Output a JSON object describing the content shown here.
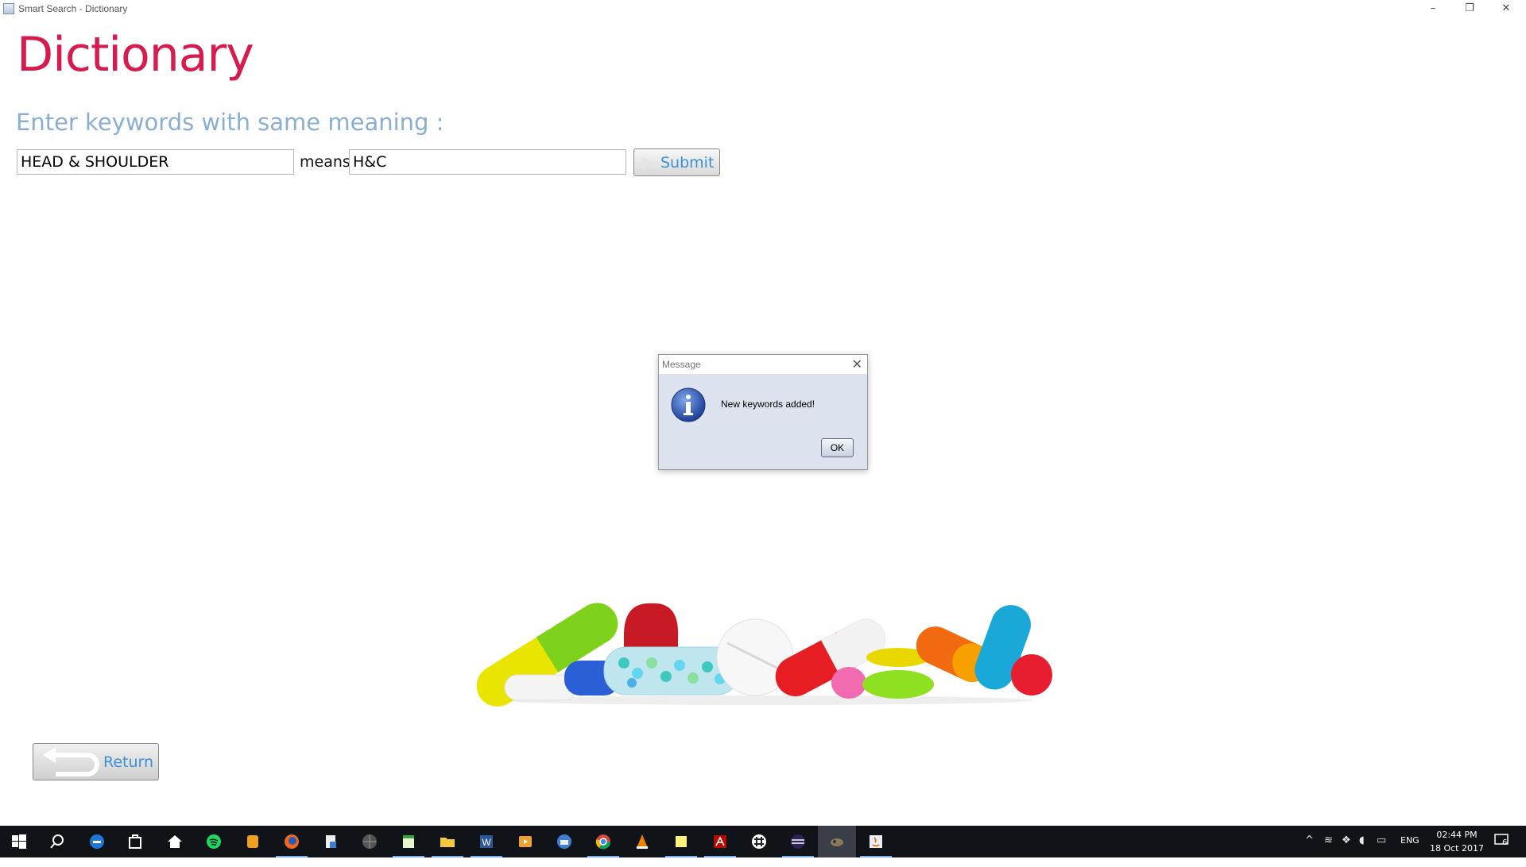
{
  "window": {
    "title": "Smart Search - Dictionary",
    "minimize_glyph": "–",
    "maximize_glyph": "❐",
    "close_glyph": "✕"
  },
  "page": {
    "heading": "Dictionary",
    "subheading": "Enter keywords with same meaning :",
    "keyword_value": "HEAD & SHOULDER",
    "means_label": "means",
    "meaning_value": "H&C",
    "submit_label": "Submit",
    "return_label": "Return"
  },
  "dialog": {
    "title": "Message",
    "close_glyph": "✕",
    "message": "New keywords added!",
    "ok_label": "OK"
  },
  "taskbar": {
    "icons": [
      "windows-start-icon",
      "search-icon",
      "edge-icon",
      "store-icon",
      "home-icon",
      "spotify-icon",
      "app-icon",
      "firefox-icon",
      "file-icon",
      "globe-icon",
      "notepad-icon",
      "file-explorer-icon",
      "word-icon",
      "media-player-icon",
      "thunderbird-icon",
      "chrome-icon",
      "vlc-icon",
      "sticky-notes-icon",
      "acrobat-icon",
      "slack-icon",
      "eclipse-icon",
      "game-icon",
      "java-icon"
    ],
    "language": "ENG",
    "time": "02:44 PM",
    "date": "18 Oct 2017",
    "notification_count": "6"
  },
  "colors": {
    "heading": "#d61b4f",
    "subheading": "#8aaed0",
    "button_text": "#3a8fd8",
    "taskbar": "#101317"
  }
}
